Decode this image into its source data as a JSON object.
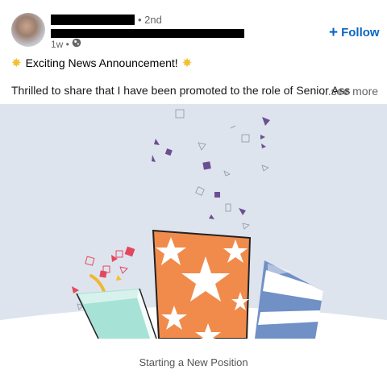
{
  "post": {
    "degree": "• 2nd",
    "time": "1w •",
    "follow_label": "Follow",
    "headline": "Exciting News Announcement!",
    "body": "Thrilled to share that I have been promoted to the role of Senior Ass",
    "see_more": "...see more",
    "caption": "Starting a New Position"
  },
  "icons": {
    "globe": "globe-icon",
    "plus": "plus-icon",
    "star": "star-icon"
  },
  "colors": {
    "accent": "#0a66c2",
    "media_bg": "#dee4ed",
    "present_orange": "#f18b4c",
    "present_blue": "#7090c6",
    "present_teal": "#a7e2d6",
    "confetti_purple": "#6b4f93",
    "confetti_red": "#e3475e"
  }
}
